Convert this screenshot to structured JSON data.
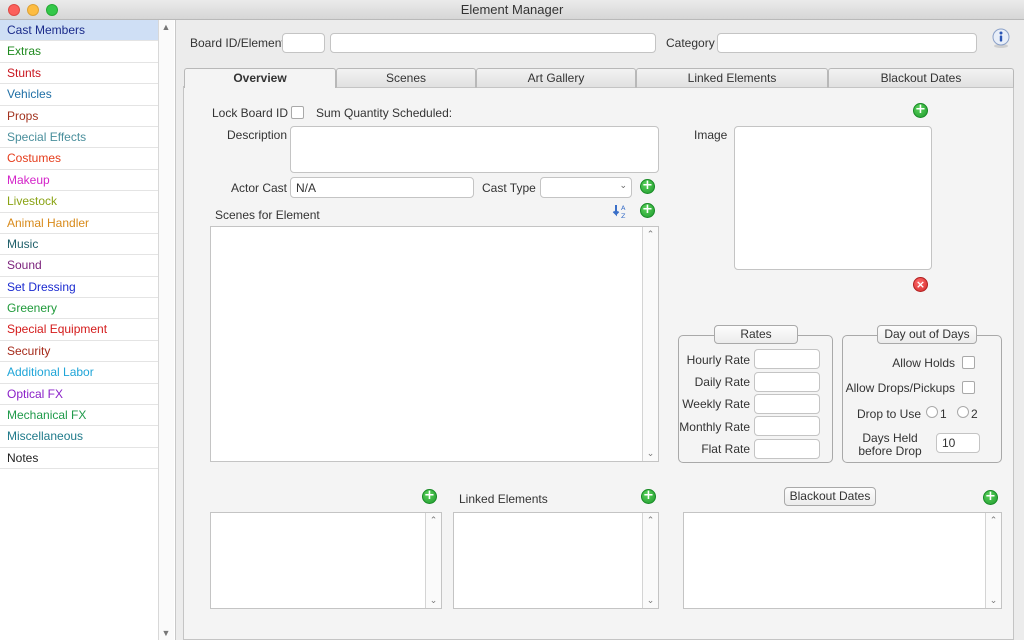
{
  "window": {
    "title": "Element Manager"
  },
  "sidebar": {
    "items": [
      {
        "label": "Cast Members",
        "color": "#1a2a8a"
      },
      {
        "label": "Extras",
        "color": "#1f8a1f"
      },
      {
        "label": "Stunts",
        "color": "#c8141e"
      },
      {
        "label": "Vehicles",
        "color": "#1f6fa5"
      },
      {
        "label": "Props",
        "color": "#a2331f"
      },
      {
        "label": "Special Effects",
        "color": "#4a8f9c"
      },
      {
        "label": "Costumes",
        "color": "#e53c1b"
      },
      {
        "label": "Makeup",
        "color": "#d424c9"
      },
      {
        "label": "Livestock",
        "color": "#8aa314"
      },
      {
        "label": "Animal Handler",
        "color": "#d88a1a"
      },
      {
        "label": "Music",
        "color": "#1f5f6a"
      },
      {
        "label": "Sound",
        "color": "#7a1f7a"
      },
      {
        "label": "Set Dressing",
        "color": "#1a2ad0"
      },
      {
        "label": "Greenery",
        "color": "#1f9a3a"
      },
      {
        "label": "Special Equipment",
        "color": "#d41a1a"
      },
      {
        "label": "Security",
        "color": "#a52a1a"
      },
      {
        "label": "Additional Labor",
        "color": "#1fa5d8"
      },
      {
        "label": "Optical FX",
        "color": "#8a1fc8"
      },
      {
        "label": "Mechanical FX",
        "color": "#1f9a4a"
      },
      {
        "label": "Miscellaneous",
        "color": "#1f7a8a"
      },
      {
        "label": "Notes",
        "color": "#222222"
      }
    ]
  },
  "header": {
    "board_id_label": "Board ID/Element",
    "board_id_value": "",
    "element_value": "",
    "category_label": "Category",
    "category_value": ""
  },
  "tabs": [
    "Overview",
    "Scenes",
    "Art Gallery",
    "Linked Elements",
    "Blackout Dates"
  ],
  "overview": {
    "lock_board_id_label": "Lock Board ID",
    "sum_quantity_label": "Sum Quantity Scheduled:",
    "description_label": "Description",
    "description_value": "",
    "actor_cast_label": "Actor Cast",
    "actor_cast_value": "N/A",
    "cast_type_label": "Cast Type",
    "cast_type_value": "",
    "scenes_label": "Scenes for Element",
    "image_label": "Image",
    "linked_elements_label": "Linked Elements",
    "blackout_dates_label": "Blackout Dates"
  },
  "rates": {
    "title": "Rates",
    "hourly": "Hourly Rate",
    "daily": "Daily Rate",
    "weekly": "Weekly Rate",
    "monthly": "Monthly Rate",
    "flat": "Flat Rate"
  },
  "day_out": {
    "title": "Day out of Days",
    "allow_holds": "Allow Holds",
    "allow_drops": "Allow Drops/Pickups",
    "drop_to_use": "Drop to Use",
    "option_1": "1",
    "option_2": "2",
    "days_held_line1": "Days Held",
    "days_held_line2": "before Drop",
    "days_held_value": "10"
  },
  "icons": {
    "add": "plus-circle-icon",
    "remove": "remove-circle-icon",
    "info": "info-icon",
    "sort": "sort-az-icon"
  }
}
